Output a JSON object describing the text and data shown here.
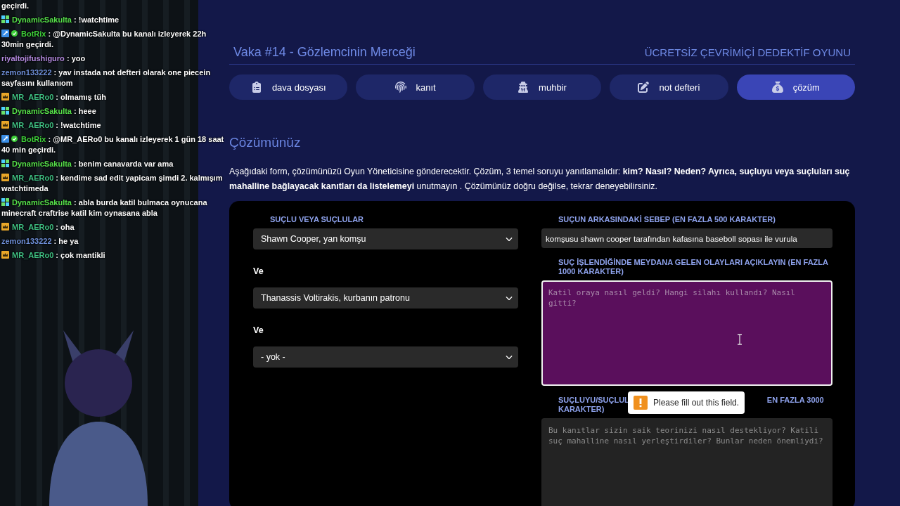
{
  "chat": {
    "messages": [
      {
        "kind": "fragment",
        "text": "geçirdi."
      },
      {
        "kind": "subscriber",
        "user": "DynamicSakulta",
        "color": "#56e04a",
        "separator": ":",
        "text": "!watchtime"
      },
      {
        "kind": "bot",
        "user": "BotRix",
        "color": "#3fd13a",
        "separator": ":",
        "text": "@DynamicSakulta bu kanalı izleyerek 22h 30min geçirdi."
      },
      {
        "kind": "plain",
        "user": "riyaltojifushiguro",
        "color": "#b48ae0",
        "separator": ":",
        "text": "yoo"
      },
      {
        "kind": "plain",
        "user": "zemon133222",
        "color": "#6e8fd8",
        "separator": ":",
        "text": "yav instada not defteri olarak one piecein sayfasını kullanıom"
      },
      {
        "kind": "vip",
        "user": "MR_AERo0",
        "color": "#3fbf82",
        "separator": ":",
        "text": "olmamış tüh"
      },
      {
        "kind": "subscriber",
        "user": "DynamicSakulta",
        "color": "#56e04a",
        "separator": ":",
        "text": "heee"
      },
      {
        "kind": "vip",
        "user": "MR_AERo0",
        "color": "#3fbf82",
        "separator": ":",
        "text": "!watchtime"
      },
      {
        "kind": "bot",
        "user": "BotRix",
        "color": "#3fd13a",
        "separator": ":",
        "text": "@MR_AERo0 bu kanalı izleyerek 1 gün 18 saat 40 min geçirdi."
      },
      {
        "kind": "subscriber",
        "user": "DynamicSakulta",
        "color": "#56e04a",
        "separator": ":",
        "text": "benim canavarda var ama"
      },
      {
        "kind": "vip",
        "user": "MR_AERo0",
        "color": "#3fbf82",
        "separator": ":",
        "text": "kendime sad edit yapicam şimdi 2. kalmışım watchtimeda"
      },
      {
        "kind": "subscriber",
        "user": "DynamicSakulta",
        "color": "#56e04a",
        "separator": ":",
        "text": "abla burda katil bulmaca oynucana minecraft craftrise katil kim oynasana abla"
      },
      {
        "kind": "vip",
        "user": "MR_AERo0",
        "color": "#3fbf82",
        "separator": ":",
        "text": "oha"
      },
      {
        "kind": "plain",
        "user": "zemon133222",
        "color": "#6e8fd8",
        "separator": ":",
        "text": "he ya"
      },
      {
        "kind": "vip",
        "user": "MR_AERo0",
        "color": "#3fbf82",
        "separator": ":",
        "text": "çok mantikli"
      }
    ]
  },
  "page": {
    "title": "Vaka #14 - Gözlemcinin Merceği",
    "tagline": "ÜCRETSİZ ÇEVRİMİÇİ DEDEKTİF OYUNU",
    "tabs": [
      {
        "label": "dava dosyası",
        "selected": false
      },
      {
        "label": "kanıt",
        "selected": false
      },
      {
        "label": "muhbir",
        "selected": false
      },
      {
        "label": "not defteri",
        "selected": false
      },
      {
        "label": "çözüm",
        "selected": true
      }
    ],
    "heading": "Çözümünüz",
    "intro": "Aşağıdaki form, çözümünüzü Oyun Yöneticisine gönderecektir. Çözüm, 3 temel soruyu yanıtlamalıdır: **kim? Nasıl? Neden? Ayrıca, suçluyu veya suçluları suç mahalline bağlayacak kanıtları da listelemeyi** unutmayın . Çözümünüz doğru değilse, tekrar deneyebilirsiniz.",
    "form": {
      "suspects": {
        "label": "SUÇLU VEYA SUÇLULAR",
        "joiners": [
          "Ve",
          "Ve"
        ],
        "selects": [
          {
            "value": "Shawn Cooper, yan komşu"
          },
          {
            "value": "Thanassis Voltirakis, kurbanın patronu"
          },
          {
            "value": "- yok -"
          }
        ]
      },
      "motive": {
        "label": "SUÇUN ARKASINDAKİ SEBEP (EN FAZLA 500 KARAKTER)",
        "value": "komşusu shawn cooper tarafından kafasına baseboll sopası ile vurula"
      },
      "events": {
        "label": "SUÇ İŞLENDİĞİNDE MEYDANA GELEN OLAYLARI AÇIKLAYIN (EN FAZLA 1000 KARAKTER)",
        "placeholder": "Katil oraya nasıl geldi? Hangi silahı kullandı? Nasıl gitti?",
        "focused": true
      },
      "evidence": {
        "label_parts": [
          "SUÇLUYU/SUÇLUL",
          "EN FAZLA 3000",
          "KARAKTER)"
        ],
        "placeholder": "Bu kanıtlar sizin saik teorinizi nasıl destekliyor? Katili suç mahalline nasıl yerleştirdiler? Bunlar neden önemliydi?",
        "focused": false
      },
      "validation_message": "Please fill out this field."
    }
  }
}
